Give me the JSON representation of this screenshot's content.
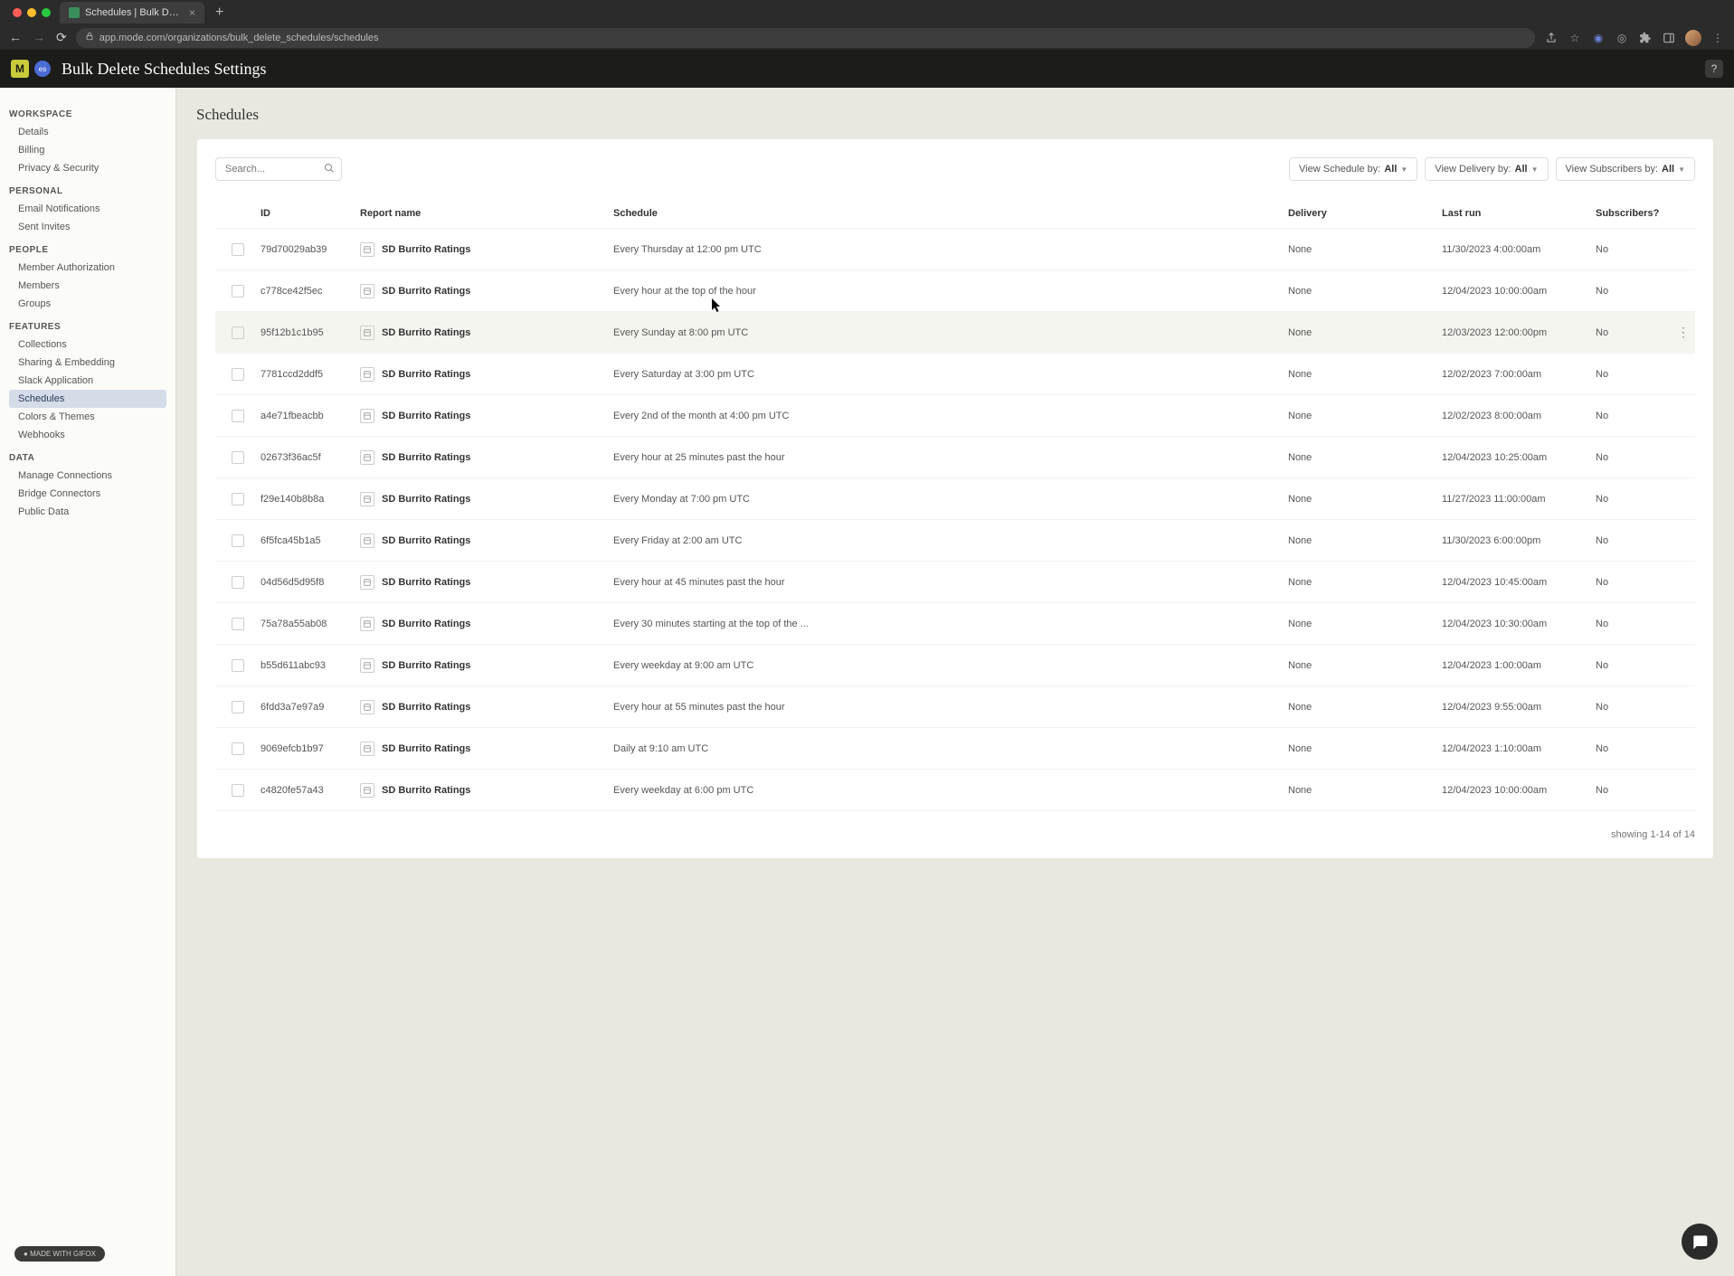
{
  "browser": {
    "tab_title": "Schedules | Bulk Delete Sched...",
    "url": "app.mode.com/organizations/bulk_delete_schedules/schedules"
  },
  "header": {
    "logo_letter": "M",
    "badge": "es",
    "title": "Bulk Delete Schedules Settings",
    "help": "?"
  },
  "sidebar": {
    "workspace_title": "WORKSPACE",
    "workspace": [
      "Details",
      "Billing",
      "Privacy & Security"
    ],
    "personal_title": "PERSONAL",
    "personal": [
      "Email Notifications",
      "Sent Invites"
    ],
    "people_title": "PEOPLE",
    "people": [
      "Member Authorization",
      "Members",
      "Groups"
    ],
    "features_title": "FEATURES",
    "features": [
      "Collections",
      "Sharing & Embedding",
      "Slack Application",
      "Schedules",
      "Colors & Themes",
      "Webhooks"
    ],
    "data_title": "DATA",
    "data": [
      "Manage Connections",
      "Bridge Connectors",
      "Public Data"
    ]
  },
  "main": {
    "title": "Schedules",
    "search_placeholder": "Search...",
    "filter_schedule_label": "View Schedule by:",
    "filter_schedule_val": "All",
    "filter_delivery_label": "View Delivery by:",
    "filter_delivery_val": "All",
    "filter_subscribers_label": "View Subscribers by:",
    "filter_subscribers_val": "All"
  },
  "columns": {
    "id": "ID",
    "report": "Report name",
    "schedule": "Schedule",
    "delivery": "Delivery",
    "last_run": "Last run",
    "subscribers": "Subscribers?"
  },
  "rows": [
    {
      "id": "79d70029ab39",
      "report": "SD Burrito Ratings",
      "schedule": "Every Thursday at 12:00 pm UTC",
      "delivery": "None",
      "last_run": "11/30/2023 4:00:00am",
      "subscribers": "No",
      "hovered": false
    },
    {
      "id": "c778ce42f5ec",
      "report": "SD Burrito Ratings",
      "schedule": "Every hour at the top of the hour",
      "delivery": "None",
      "last_run": "12/04/2023 10:00:00am",
      "subscribers": "No",
      "hovered": false
    },
    {
      "id": "95f12b1c1b95",
      "report": "SD Burrito Ratings",
      "schedule": "Every Sunday at 8:00 pm UTC",
      "delivery": "None",
      "last_run": "12/03/2023 12:00:00pm",
      "subscribers": "No",
      "hovered": true
    },
    {
      "id": "7781ccd2ddf5",
      "report": "SD Burrito Ratings",
      "schedule": "Every Saturday at 3:00 pm UTC",
      "delivery": "None",
      "last_run": "12/02/2023 7:00:00am",
      "subscribers": "No",
      "hovered": false
    },
    {
      "id": "a4e71fbeacbb",
      "report": "SD Burrito Ratings",
      "schedule": "Every 2nd of the month at 4:00 pm UTC",
      "delivery": "None",
      "last_run": "12/02/2023 8:00:00am",
      "subscribers": "No",
      "hovered": false
    },
    {
      "id": "02673f36ac5f",
      "report": "SD Burrito Ratings",
      "schedule": "Every hour at 25 minutes past the hour",
      "delivery": "None",
      "last_run": "12/04/2023 10:25:00am",
      "subscribers": "No",
      "hovered": false
    },
    {
      "id": "f29e140b8b8a",
      "report": "SD Burrito Ratings",
      "schedule": "Every Monday at 7:00 pm UTC",
      "delivery": "None",
      "last_run": "11/27/2023 11:00:00am",
      "subscribers": "No",
      "hovered": false
    },
    {
      "id": "6f5fca45b1a5",
      "report": "SD Burrito Ratings",
      "schedule": "Every Friday at 2:00 am UTC",
      "delivery": "None",
      "last_run": "11/30/2023 6:00:00pm",
      "subscribers": "No",
      "hovered": false
    },
    {
      "id": "04d56d5d95f8",
      "report": "SD Burrito Ratings",
      "schedule": "Every hour at 45 minutes past the hour",
      "delivery": "None",
      "last_run": "12/04/2023 10:45:00am",
      "subscribers": "No",
      "hovered": false
    },
    {
      "id": "75a78a55ab08",
      "report": "SD Burrito Ratings",
      "schedule": "Every 30 minutes starting at the top of the ...",
      "delivery": "None",
      "last_run": "12/04/2023 10:30:00am",
      "subscribers": "No",
      "hovered": false
    },
    {
      "id": "b55d611abc93",
      "report": "SD Burrito Ratings",
      "schedule": "Every weekday at 9:00 am UTC",
      "delivery": "None",
      "last_run": "12/04/2023 1:00:00am",
      "subscribers": "No",
      "hovered": false
    },
    {
      "id": "6fdd3a7e97a9",
      "report": "SD Burrito Ratings",
      "schedule": "Every hour at 55 minutes past the hour",
      "delivery": "None",
      "last_run": "12/04/2023 9:55:00am",
      "subscribers": "No",
      "hovered": false
    },
    {
      "id": "9069efcb1b97",
      "report": "SD Burrito Ratings",
      "schedule": "Daily at 9:10 am UTC",
      "delivery": "None",
      "last_run": "12/04/2023 1:10:00am",
      "subscribers": "No",
      "hovered": false
    },
    {
      "id": "c4820fe57a43",
      "report": "SD Burrito Ratings",
      "schedule": "Every weekday at 6:00 pm UTC",
      "delivery": "None",
      "last_run": "12/04/2023 10:00:00am",
      "subscribers": "No",
      "hovered": false
    }
  ],
  "footer": "showing 1-14 of 14",
  "gifox": "MADE WITH GIFOX"
}
